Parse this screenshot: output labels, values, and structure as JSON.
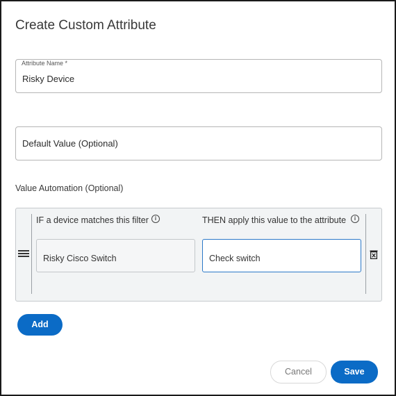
{
  "dialog": {
    "title": "Create Custom Attribute"
  },
  "attribute_name": {
    "label": "Attribute Name *",
    "value": "Risky Device"
  },
  "default_value": {
    "placeholder": "Default Value (Optional)",
    "value": ""
  },
  "value_automation": {
    "label": "Value Automation (Optional)",
    "if_header": "IF a device matches this filter",
    "then_header": "THEN apply this value to the attribute",
    "rows": [
      {
        "filter": "Risky Cisco Switch",
        "value": "Check switch"
      }
    ]
  },
  "buttons": {
    "add": "Add",
    "cancel": "Cancel",
    "save": "Save"
  },
  "colors": {
    "primary": "#0b6bc6",
    "focus_border": "#2a78c8"
  },
  "icons": {
    "drag": "drag-handle-icon",
    "info": "info-icon",
    "delete": "trash-icon"
  }
}
